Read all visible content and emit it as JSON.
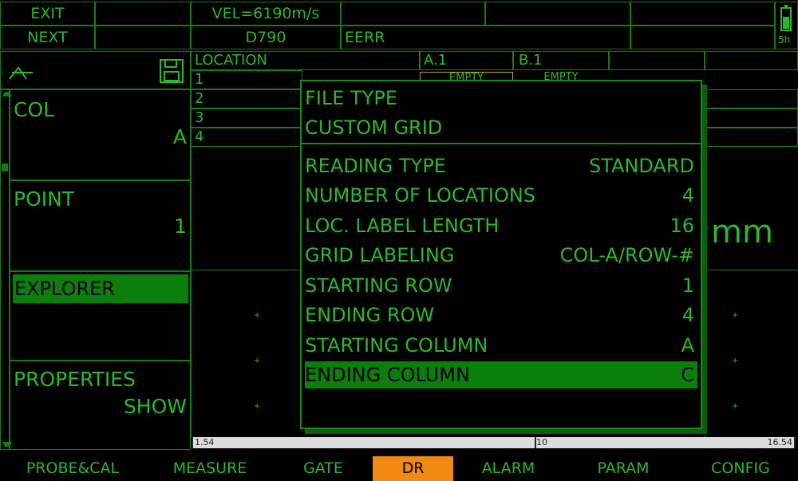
{
  "header": {
    "exit_label": "EXIT",
    "next_label": "NEXT",
    "velocity": "VEL=6190m/s",
    "probe": "D790",
    "file_name": "EERR",
    "battery_time": "5h"
  },
  "left_panel": {
    "col_label": "COL",
    "col_value": "A",
    "point_label": "POINT",
    "point_value": "1",
    "explorer_label": "EXPLORER",
    "properties_label": "PROPERTIES",
    "properties_value": "SHOW"
  },
  "grid": {
    "location_header": "LOCATION",
    "col_a": "A.1",
    "col_b": "B.1",
    "rows": [
      "1",
      "2",
      "3",
      "4"
    ],
    "empty_a": "EMPTY",
    "empty_b": "EMPTY",
    "unit": "mm"
  },
  "dialog": {
    "file_type": "FILE TYPE",
    "custom_grid": "CUSTOM GRID",
    "params": [
      {
        "key": "READING TYPE",
        "value": "STANDARD"
      },
      {
        "key": "NUMBER OF LOCATIONS",
        "value": "4"
      },
      {
        "key": "LOC. LABEL LENGTH",
        "value": "16"
      },
      {
        "key": "GRID LABELING",
        "value": "COL-A/ROW-#"
      },
      {
        "key": "STARTING ROW",
        "value": "1"
      },
      {
        "key": "ENDING ROW",
        "value": "4"
      },
      {
        "key": "STARTING COLUMN",
        "value": "A"
      },
      {
        "key": "ENDING COLUMN",
        "value": "C"
      }
    ]
  },
  "ruler": {
    "min": "1.54",
    "mid": "10",
    "max": "16.54"
  },
  "menu": [
    {
      "label": "PROBE&CAL"
    },
    {
      "label": "MEASURE"
    },
    {
      "label": "GATE"
    },
    {
      "label": "DR"
    },
    {
      "label": "ALARM"
    },
    {
      "label": "PARAM"
    },
    {
      "label": "CONFIG"
    }
  ],
  "colors": {
    "text_green": "#2db82d",
    "highlight_green": "#0b7f0b",
    "active_tab": "#f08a10"
  }
}
